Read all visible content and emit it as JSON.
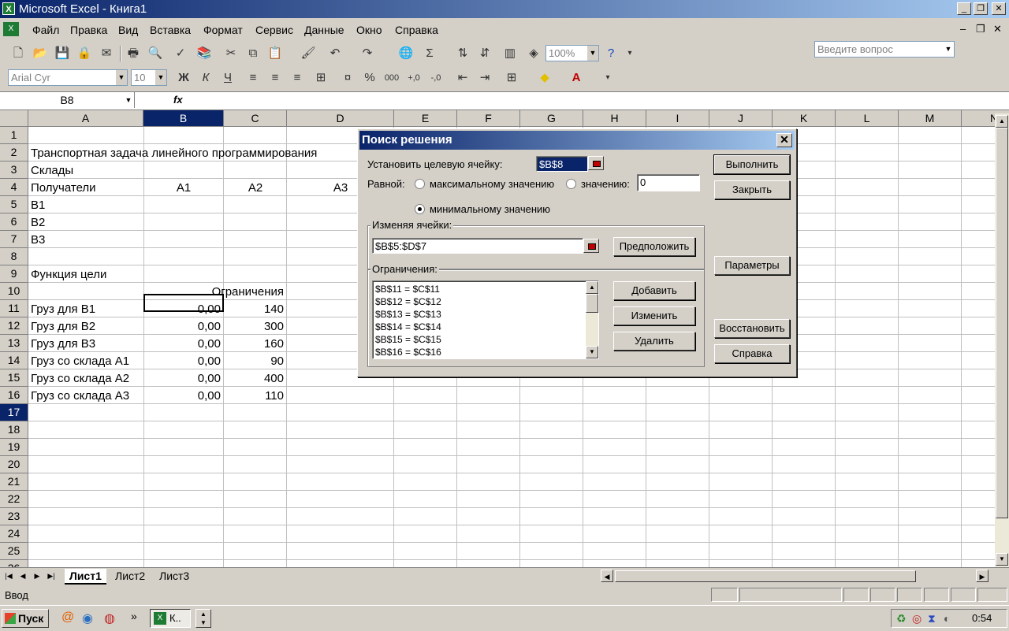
{
  "window": {
    "title": "Microsoft Excel - Книга1"
  },
  "menu": {
    "items": [
      "Файл",
      "Правка",
      "Вид",
      "Вставка",
      "Формат",
      "Сервис",
      "Данные",
      "Окно",
      "Справка"
    ],
    "ask_placeholder": "Введите вопрос"
  },
  "toolbar": {
    "zoom": "100%",
    "font": "Arial Cyr",
    "size": "10"
  },
  "formula": {
    "namebox": "B8",
    "fx": "fx"
  },
  "grid": {
    "columns": [
      "A",
      "B",
      "C",
      "D",
      "E",
      "F",
      "G",
      "H",
      "I",
      "J",
      "K",
      "L",
      "M",
      "N"
    ],
    "rows": [
      "1",
      "2",
      "3",
      "4",
      "5",
      "6",
      "7",
      "8",
      "9",
      "10",
      "11",
      "12",
      "13",
      "14",
      "15",
      "16",
      "17",
      "18",
      "19",
      "20",
      "21",
      "22",
      "23",
      "24",
      "25",
      "26"
    ],
    "cells": {
      "a2": "Транспортная задача линейного программирования",
      "a3": "Склады",
      "a4": "Получатели",
      "b4": "A1",
      "c4": "A2",
      "d4": "A3",
      "a5": "B1",
      "a6": "B2",
      "a7": "B3",
      "a9": "Функция цели",
      "b10": "Ограничения",
      "a11": "Груз для B1",
      "b11": "0,00",
      "c11": "140",
      "a12": "Груз для B2",
      "b12": "0,00",
      "c12": "300",
      "a13": "Груз для B3",
      "b13": "0,00",
      "c13": "160",
      "a14": "Груз со склада A1",
      "b14": "0,00",
      "c14": "90",
      "a15": "Груз со склада A2",
      "b15": "0,00",
      "c15": "400",
      "a16": "Груз со склада A3",
      "b16": "0,00",
      "c16": "110"
    }
  },
  "sheets": [
    "Лист1",
    "Лист2",
    "Лист3"
  ],
  "status": {
    "mode": "Ввод"
  },
  "taskbar": {
    "start": "Пуск",
    "task": "К..",
    "clock": "0:54"
  },
  "dialog": {
    "title": "Поиск решения",
    "target_label": "Установить целевую ячейку:",
    "target_value": "$B$8",
    "equal_label": "Равной:",
    "opt_max": "максимальному значению",
    "opt_value": "значению:",
    "value_field": "0",
    "opt_min": "минимальному значению",
    "selected_option": "min",
    "changing_label": "Изменяя ячейки:",
    "changing_value": "$B$5:$D$7",
    "constraints_label": "Ограничения:",
    "constraints": [
      "$B$11 = $C$11",
      "$B$12 = $C$12",
      "$B$13 = $C$13",
      "$B$14 = $C$14",
      "$B$15 = $C$15",
      "$B$16 = $C$16"
    ],
    "buttons": {
      "solve": "Выполнить",
      "close": "Закрыть",
      "guess": "Предположить",
      "options": "Параметры",
      "add": "Добавить",
      "change": "Изменить",
      "delete": "Удалить",
      "reset": "Восстановить",
      "help": "Справка"
    }
  }
}
